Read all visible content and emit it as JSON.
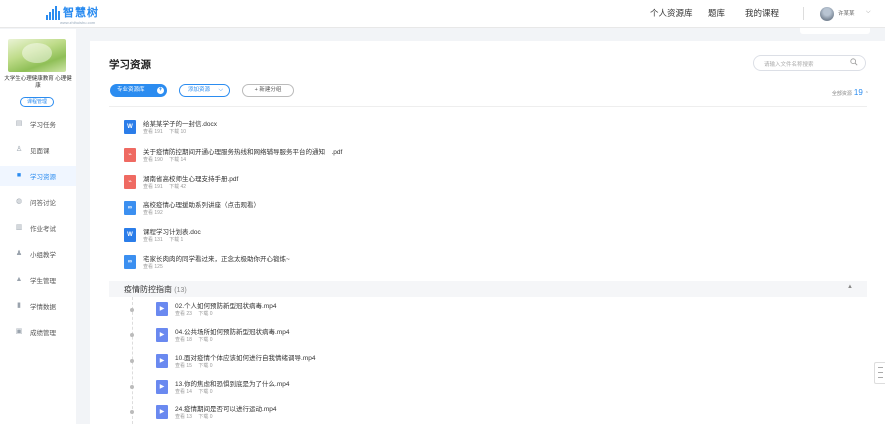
{
  "brand": {
    "name": "智慧树",
    "sub": "www.zhihuishu.com"
  },
  "nav": {
    "items": [
      "个人资源库",
      "题库",
      "我的课程"
    ],
    "user_name": "许某某"
  },
  "sidebar": {
    "course_title": "大学生心理健康教育 心理健康",
    "course_button": "课程管理",
    "items": [
      {
        "label": "学习任务",
        "icon": "task-icon"
      },
      {
        "label": "见面课",
        "icon": "person-icon"
      },
      {
        "label": "学习资源",
        "icon": "resource-icon",
        "active": true
      },
      {
        "label": "问答讨论",
        "icon": "discussion-icon"
      },
      {
        "label": "作业考试",
        "icon": "exam-icon"
      },
      {
        "label": "小组教学",
        "icon": "group-icon"
      },
      {
        "label": "学生管理",
        "icon": "student-icon"
      },
      {
        "label": "学情数据",
        "icon": "chart-icon"
      },
      {
        "label": "成绩管理",
        "icon": "grade-icon"
      }
    ]
  },
  "main": {
    "title": "学习资源",
    "search_placeholder": "请输入文件名称搜索",
    "btn_primary": "专业资源库",
    "btn_add": "添加资源",
    "btn_group": "+ 新建分组",
    "total_label": "全部资源",
    "total_count": "19",
    "files": [
      {
        "name": "给某某学子的一封信.docx",
        "meta": "查看 191　 下载 10",
        "type": "word"
      },
      {
        "name": "关于疫情防控期间开通心理服务热线和网络辅导服务平台的通知　.pdf",
        "meta": "查看 190　 下载 14",
        "type": "pdf"
      },
      {
        "name": "湖南省高校师生心理支持手册.pdf",
        "meta": "查看 191　 下载 42",
        "type": "pdf"
      },
      {
        "name": "高校疫情心理援助系列讲座（点击观看）",
        "meta": "查看 192",
        "type": "link"
      },
      {
        "name": "课程学习计划表.doc",
        "meta": "查看 131　 下载 1",
        "type": "word"
      },
      {
        "name": "宅家长肉肉的同学看过来，正念太极助你开心锻炼~",
        "meta": "查看 125",
        "type": "link"
      }
    ],
    "group": {
      "title": "疫情防控指南",
      "count": "(13)",
      "files": [
        {
          "name": "02.个人如何预防新型冠状病毒.mp4",
          "meta": "查看 23　 下载 0"
        },
        {
          "name": "04.公共场所如何预防新型冠状病毒.mp4",
          "meta": "查看 18　 下载 0"
        },
        {
          "name": "10.面对疫情个体应该如何进行自我情绪调导.mp4",
          "meta": "查看 15　 下载 0"
        },
        {
          "name": "13.你的焦虑和恐惧到底是为了什么.mp4",
          "meta": "查看 14　 下载 0"
        },
        {
          "name": "24.疫情期间是否可以进行运动.mp4",
          "meta": "查看 13　 下载 0"
        }
      ]
    }
  }
}
